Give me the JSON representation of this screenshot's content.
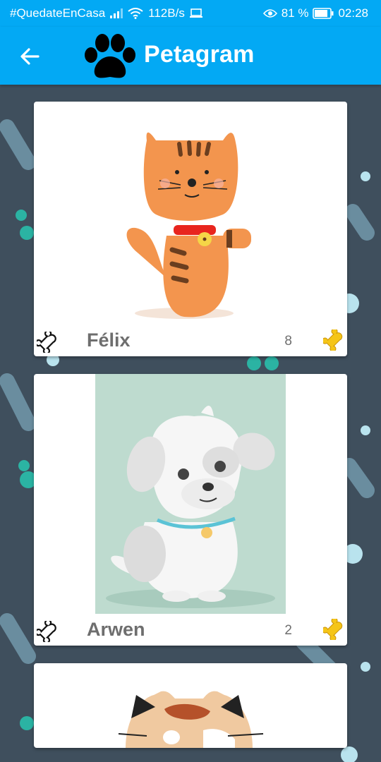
{
  "status_bar": {
    "carrier": "#QuedateEnCasa",
    "speed": "112B/s",
    "battery": "81 %",
    "time": "02:28",
    "icons": [
      "signal-icon",
      "wifi-icon",
      "screen-cast-icon",
      "eye-icon",
      "battery-icon"
    ]
  },
  "app_bar": {
    "title": "Petagram",
    "back_icon": "arrow-back-icon",
    "logo_icon": "paw-icon",
    "color": "#03a9f4"
  },
  "pets": [
    {
      "name": "Félix",
      "likes": "8",
      "photo": "cat-illustration"
    },
    {
      "name": "Arwen",
      "likes": "2",
      "photo": "dog-illustration"
    },
    {
      "name": "",
      "likes": "",
      "photo": "calico-cat-illustration"
    }
  ],
  "icons": {
    "rate_button": "bone-outline-icon",
    "likes": "bone-yellow-icon"
  },
  "colors": {
    "background": "#3f4f5d",
    "bone_yellow": "#f5c518"
  }
}
